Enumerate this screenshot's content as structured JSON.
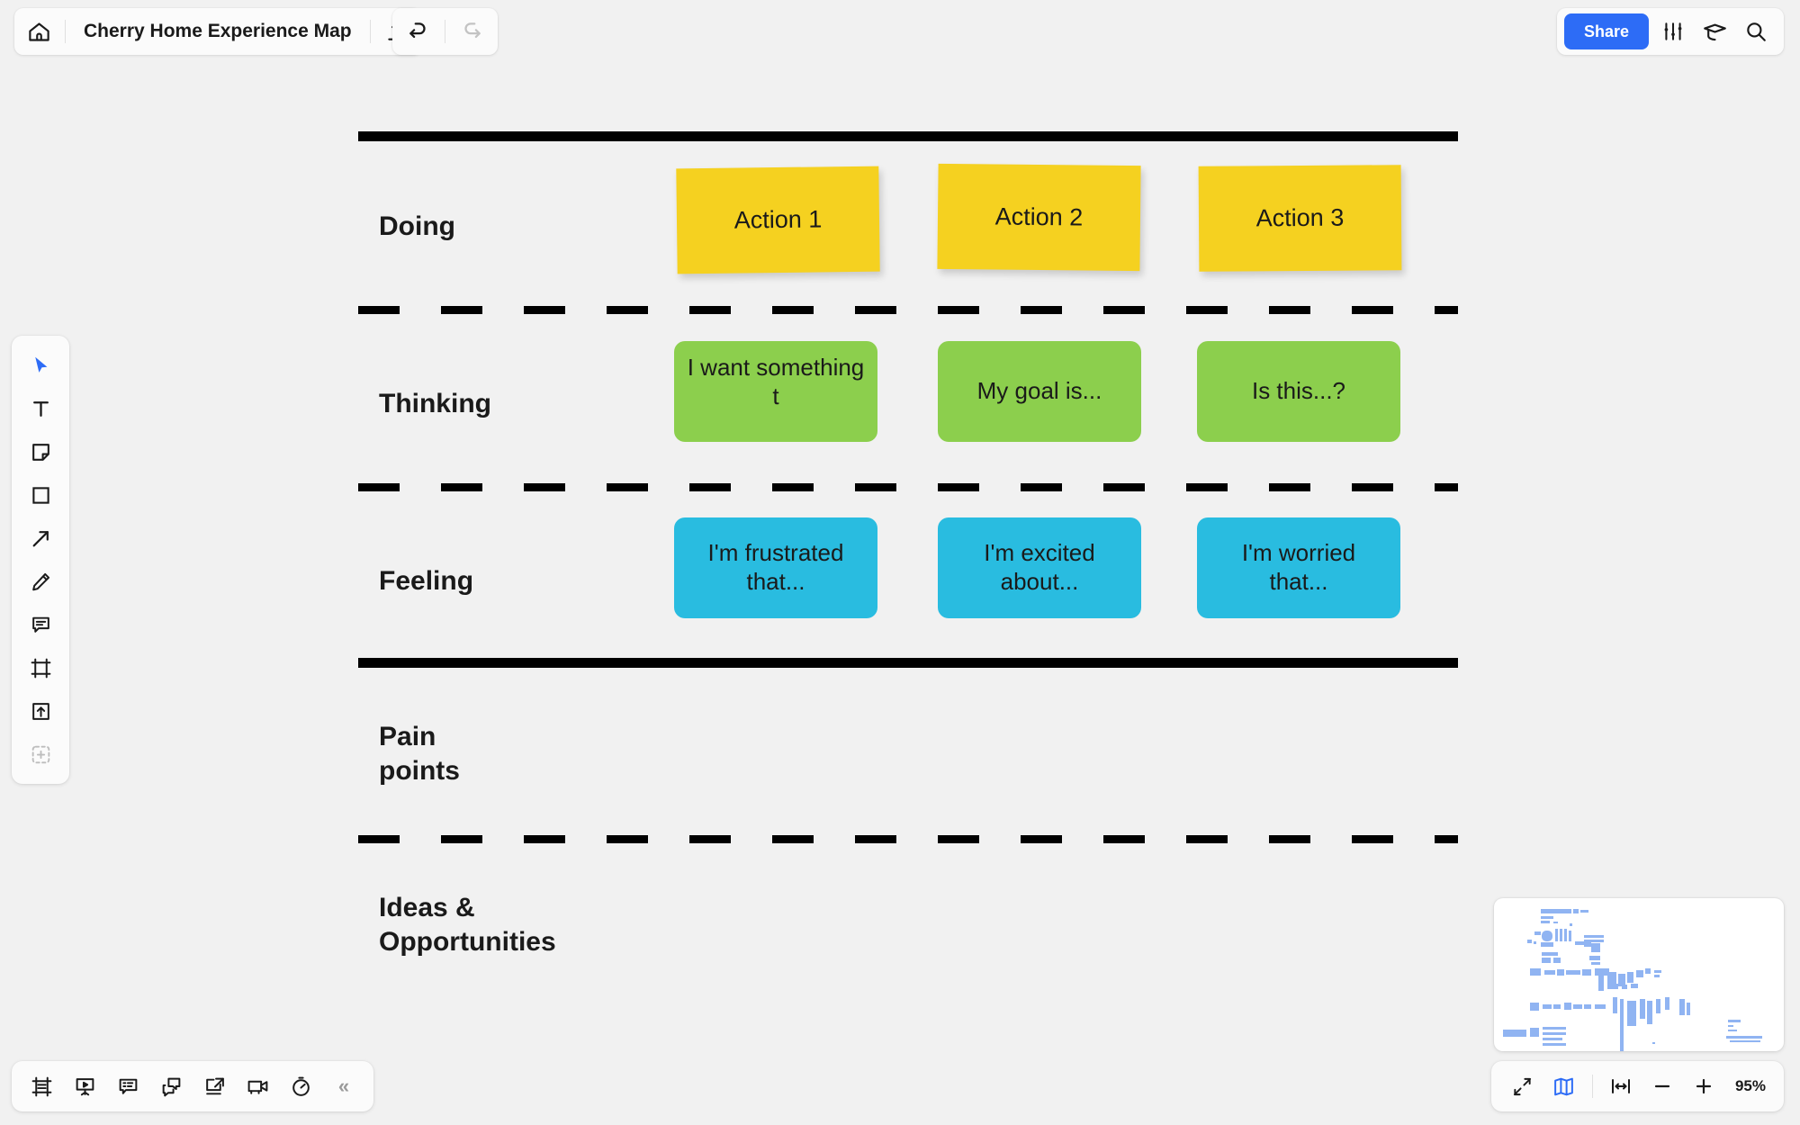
{
  "app": {
    "background_color": "#f1f1f1",
    "accent_color": "#2d6cf6"
  },
  "header": {
    "home_icon": "home-icon",
    "title": "Cherry Home Experience Map",
    "upload_icon": "upload-icon",
    "undo_icon": "undo-icon",
    "redo_icon": "redo-icon",
    "share_label": "Share",
    "settings_icon": "sliders-icon",
    "learn_icon": "graduation-cap-icon",
    "search_icon": "search-icon"
  },
  "left_toolbar": {
    "items": [
      {
        "name": "select-tool",
        "icon": "cursor-icon",
        "active": true
      },
      {
        "name": "text-tool",
        "icon": "text-icon",
        "active": false
      },
      {
        "name": "sticky-note-tool",
        "icon": "sticky-note-icon",
        "active": false
      },
      {
        "name": "shape-tool",
        "icon": "square-icon",
        "active": false
      },
      {
        "name": "arrow-tool",
        "icon": "arrow-icon",
        "active": false
      },
      {
        "name": "pen-tool",
        "icon": "pencil-icon",
        "active": false
      },
      {
        "name": "comment-tool",
        "icon": "comment-icon",
        "active": false
      },
      {
        "name": "frame-tool",
        "icon": "frame-icon",
        "active": false
      },
      {
        "name": "upload-tool",
        "icon": "upload-box-icon",
        "active": false
      },
      {
        "name": "more-apps-tool",
        "icon": "plus-dashed-icon",
        "active": false
      }
    ]
  },
  "bottom_toolbar": {
    "items": [
      {
        "name": "frames-panel-button",
        "icon": "frames-icon"
      },
      {
        "name": "presentation-button",
        "icon": "presentation-icon"
      },
      {
        "name": "comments-button",
        "icon": "comments-icon"
      },
      {
        "name": "chat-button",
        "icon": "chat-icon"
      },
      {
        "name": "export-button",
        "icon": "export-icon"
      },
      {
        "name": "video-chat-button",
        "icon": "video-camera-icon"
      },
      {
        "name": "timer-button",
        "icon": "timer-icon"
      }
    ],
    "collapse_label": "«"
  },
  "zoom_controls": {
    "fit_screen_icon": "collapse-arrows-icon",
    "minimap_icon": "map-icon",
    "zoom_to_fit_icon": "fit-width-icon",
    "zoom_out_label": "−",
    "zoom_in_label": "+",
    "zoom_level": "95%"
  },
  "board": {
    "rows": [
      {
        "label": "Doing"
      },
      {
        "label": "Thinking"
      },
      {
        "label": "Feeling"
      },
      {
        "label": "Pain\npoints"
      },
      {
        "label": "Ideas &\nOpportunities"
      }
    ],
    "doing_notes": [
      {
        "text": "Action 1",
        "color": "#f5d120"
      },
      {
        "text": "Action 2",
        "color": "#f5d120"
      },
      {
        "text": "Action 3",
        "color": "#f5d120"
      }
    ],
    "thinking_bubbles": [
      {
        "text": "I want something t",
        "color": "#8ccf4d"
      },
      {
        "text": "My goal is...",
        "color": "#8ccf4d"
      },
      {
        "text": "Is this...?",
        "color": "#8ccf4d"
      }
    ],
    "feeling_bubbles": [
      {
        "text": "I'm frustrated that...",
        "color": "#29bce0"
      },
      {
        "text": "I'm excited about...",
        "color": "#29bce0"
      },
      {
        "text": "I'm worried that...",
        "color": "#29bce0"
      }
    ]
  }
}
